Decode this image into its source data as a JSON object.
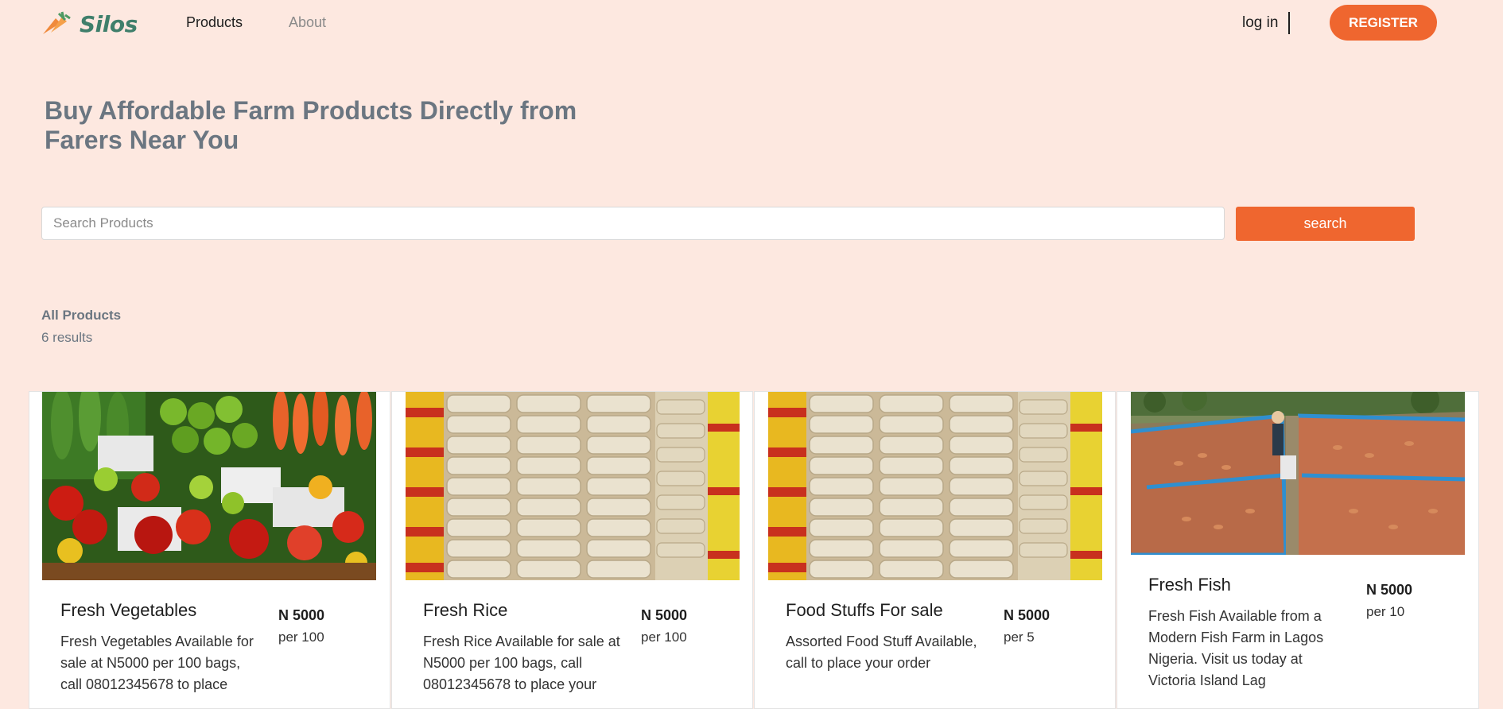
{
  "brand": {
    "name": "Silos"
  },
  "nav": {
    "products": "Products",
    "about": "About",
    "login": "log in",
    "register": "REGISTER"
  },
  "hero": {
    "title_line1": "Buy Affordable Farm Products Directly from",
    "title_line2": "Farers Near You"
  },
  "search": {
    "placeholder": "Search Products",
    "value": "",
    "button": "search"
  },
  "results": {
    "title": "All Products",
    "count": "6 results"
  },
  "products": [
    {
      "title": "Fresh Vegetables",
      "price": "N 5000",
      "unit": "per 100",
      "description": "Fresh Vegetables Available for sale at N5000 per 100 bags, call 08012345678 to place",
      "image": "vegetables"
    },
    {
      "title": "Fresh Rice",
      "price": "N 5000",
      "unit": "per 100",
      "description": "Fresh Rice Available for sale at N5000 per 100 bags, call 08012345678 to place your",
      "image": "rice-bags"
    },
    {
      "title": "Food Stuffs For sale",
      "price": "N 5000",
      "unit": "per 5",
      "description": "Assorted Food Stuff Available, call to place your order",
      "image": "rice-bags"
    },
    {
      "title": "Fresh Fish",
      "price": "N 5000",
      "unit": "per 10",
      "description": "Fresh Fish Available from a Modern Fish Farm in Lagos Nigeria. Visit us today at Victoria Island Lag",
      "image": "fish-farm"
    }
  ],
  "colors": {
    "accent": "#ef662f",
    "background": "#fde8e0",
    "brand": "#3f7f6b",
    "muted": "#6b7681"
  }
}
